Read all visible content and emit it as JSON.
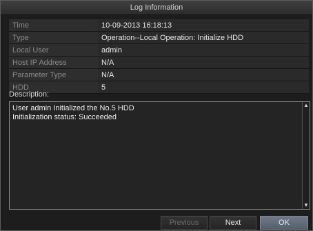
{
  "dialog": {
    "title": "Log Information"
  },
  "info_rows": [
    {
      "label": "Time",
      "value": "10-09-2013 16:18:13"
    },
    {
      "label": "Type",
      "value": "Operation--Local Operation: Initialize HDD"
    },
    {
      "label": "Local User",
      "value": "admin"
    },
    {
      "label": "Host IP Address",
      "value": "N/A"
    },
    {
      "label": "Parameter Type",
      "value": "N/A"
    },
    {
      "label": "HDD",
      "value": "5"
    }
  ],
  "description": {
    "label": "Description:",
    "lines": [
      "User admin Initialized the No.5 HDD",
      "Initialization status: Succeeded"
    ]
  },
  "scrollbar": {
    "up_icon": "▲",
    "down_icon": "▼"
  },
  "buttons": {
    "previous": "Previous",
    "next": "Next",
    "ok": "OK"
  },
  "colors": {
    "ok_button": "#5f6977",
    "previous_disabled_text": "#6e6e6e"
  }
}
